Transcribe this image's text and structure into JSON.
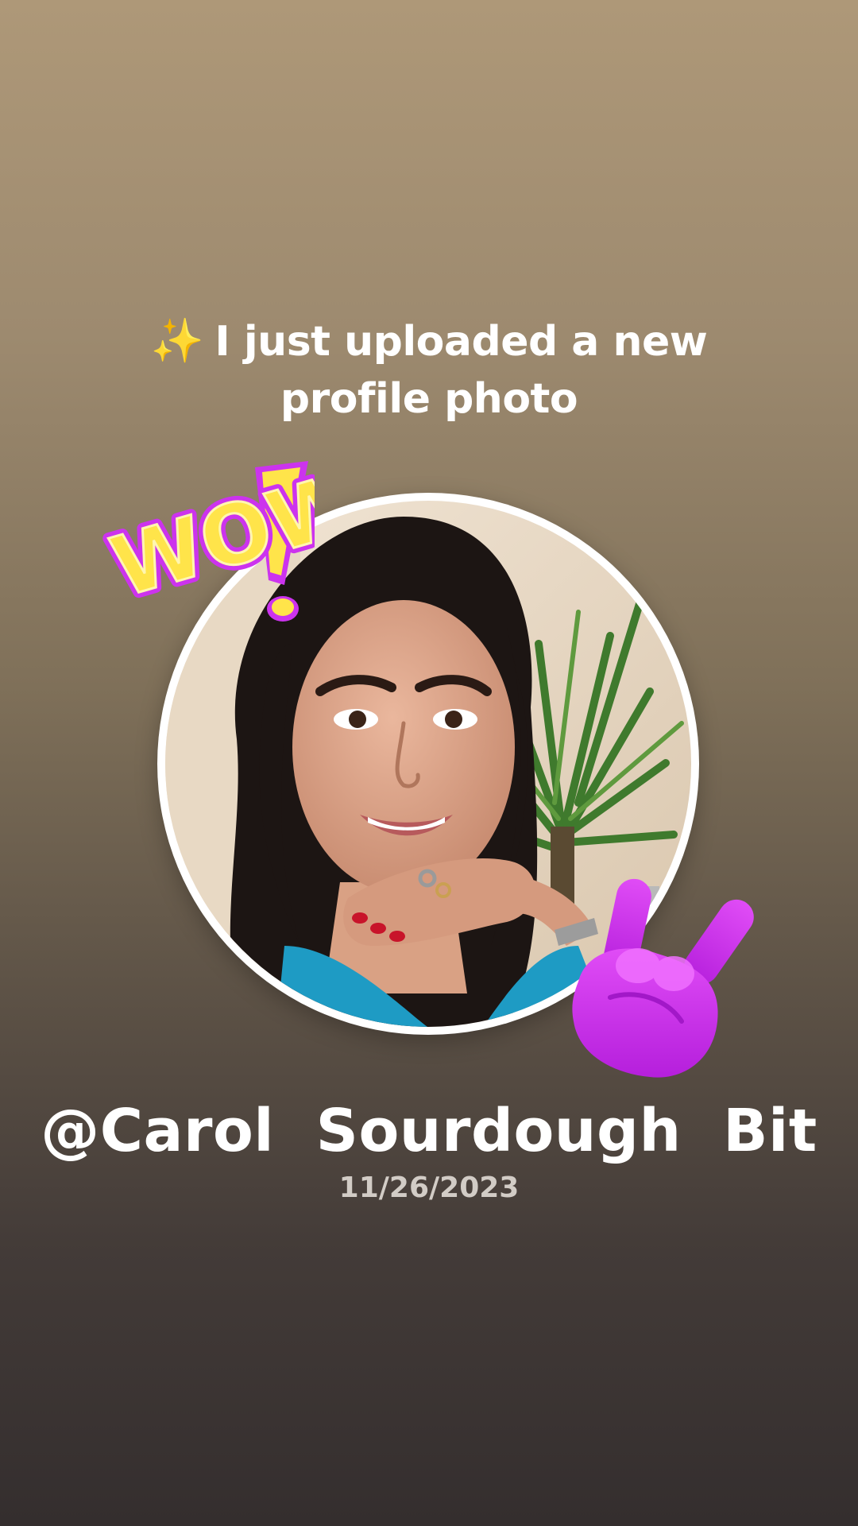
{
  "story": {
    "headline_icon": "✨",
    "headline_text": "I just uploaded a new profile photo",
    "username": "@Carol  Sourdough  Bit",
    "date": "11/26/2023",
    "stickers": [
      {
        "name": "wow-sticker",
        "text": "WOW!"
      },
      {
        "name": "rock-hand-sticker",
        "icon": "sign-of-the-horns"
      }
    ]
  },
  "colors": {
    "background_top": "#ae9878",
    "background_bottom": "#342e2e",
    "avatar_ring": "#ffffff",
    "sticker_purple": "#cc33ee",
    "sticker_yellow": "#ffe44a"
  }
}
